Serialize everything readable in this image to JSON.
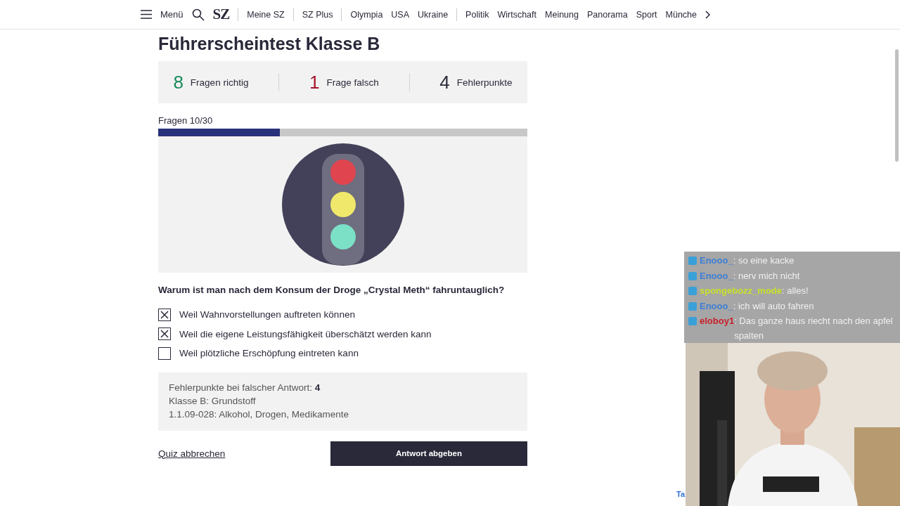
{
  "nav": {
    "menu_label": "Menü",
    "logo": "SZ",
    "items": [
      {
        "label": "Meine SZ",
        "divider_after": true
      },
      {
        "label": "SZ Plus",
        "divider_after": true
      },
      {
        "label": "Olympia",
        "divider_after": false
      },
      {
        "label": "USA",
        "divider_after": false
      },
      {
        "label": "Ukraine",
        "divider_after": true
      },
      {
        "label": "Politik",
        "divider_after": false
      },
      {
        "label": "Wirtschaft",
        "divider_after": false
      },
      {
        "label": "Meinung",
        "divider_after": false
      },
      {
        "label": "Panorama",
        "divider_after": false
      },
      {
        "label": "Sport",
        "divider_after": false
      },
      {
        "label": "Münche",
        "divider_after": false
      }
    ]
  },
  "title": "Führerscheintest Klasse B",
  "stats": [
    {
      "number": "8",
      "label": "Fragen richtig",
      "color": "#1a8a5a"
    },
    {
      "number": "1",
      "label": "Frage falsch",
      "color": "#a3162a"
    },
    {
      "number": "4",
      "label": "Fehlerpunkte",
      "color": "#29293a"
    }
  ],
  "progress": {
    "label": "Fragen 10/30",
    "level": 0.33
  },
  "question": "Warum ist man nach dem Konsum der Droge „Crystal Meth“ fahruntauglich?",
  "answers": [
    {
      "label": "Weil Wahnvorstellungen auftreten können",
      "checked": true
    },
    {
      "label": "Weil die eigene Leistungsfähigkeit überschätzt werden kann",
      "checked": true
    },
    {
      "label": "Weil plötzliche Erschöpfung eintreten kann",
      "checked": false
    }
  ],
  "info": [
    "Fehlerpunkte bei falscher Antwort: **4**",
    "Klasse B: Grundstoff",
    "1.1.09-028: Alkohol, Drogen, Medikamente"
  ],
  "cancel_link": "Quiz abbrechen",
  "submit_button": "Antwort abgeben",
  "chat": [
    {
      "user": "Enooo_",
      "message": ": so eine kacke",
      "color": "#3d7fd6"
    },
    {
      "user": "Enooo_",
      "message": ": nerv mich nicht",
      "color": "#3d7fd6"
    },
    {
      "user": "spongebozz_mode",
      "message": ": alles!",
      "color": "#c9e02a"
    },
    {
      "user": "Enooo_",
      "message": ": ich will auto fahren",
      "color": "#3d7fd6"
    },
    {
      "user": "eloboy1",
      "message": ": Das ganze haus riecht nach den apfel spalten",
      "color": "#c8202a"
    }
  ],
  "corner_text": "Ta"
}
